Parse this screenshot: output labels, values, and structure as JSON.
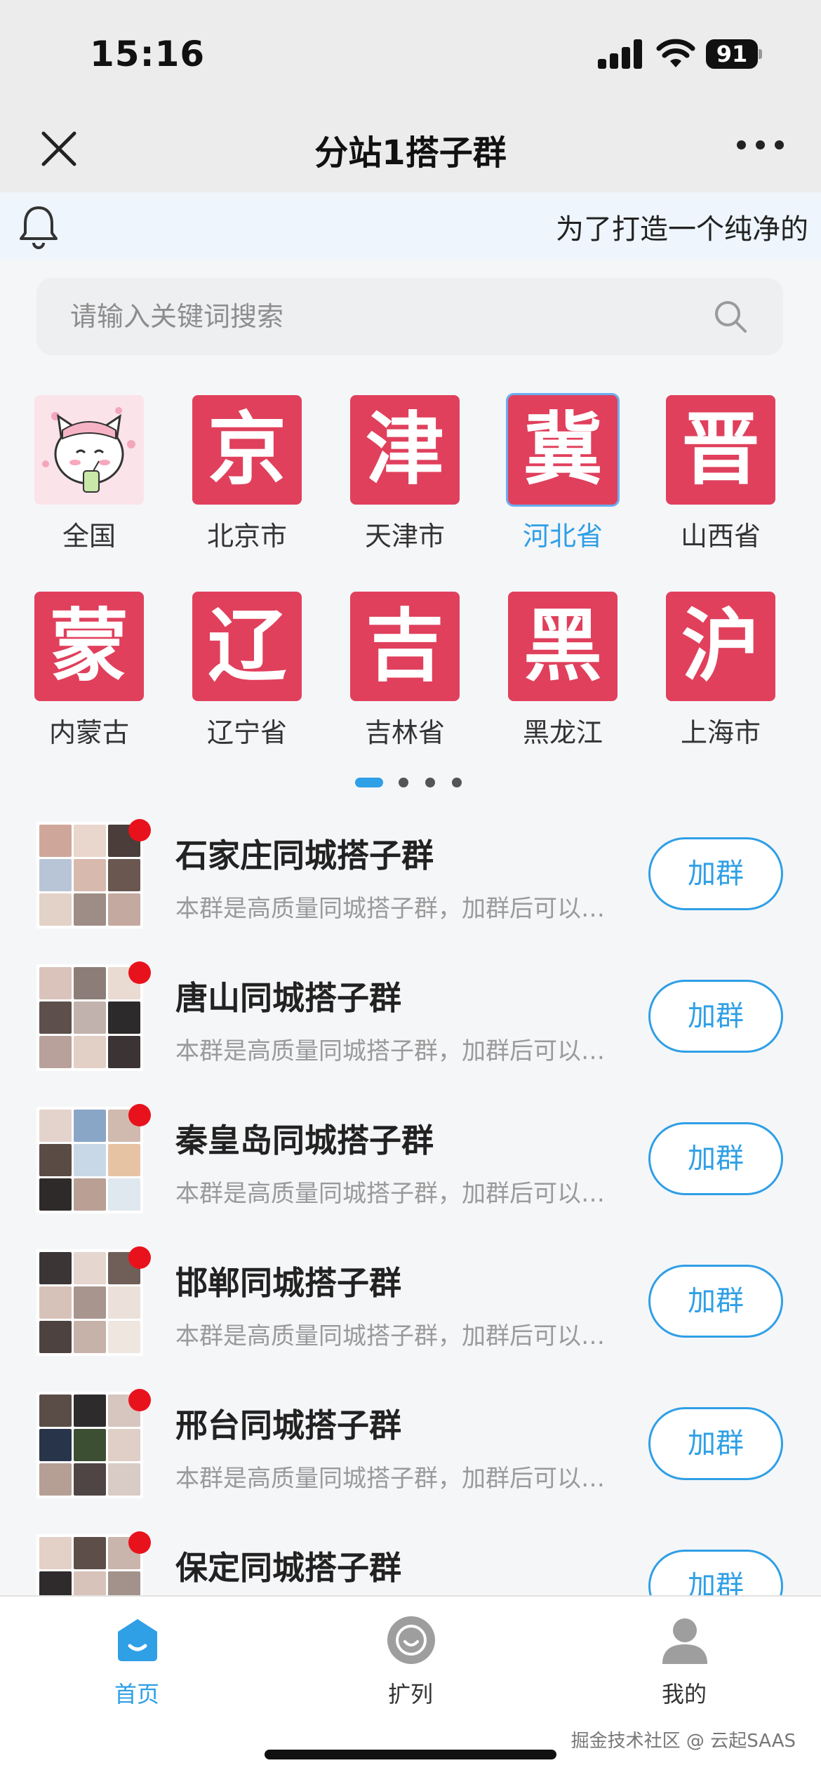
{
  "status_bar": {
    "time": "15:16",
    "battery": "91"
  },
  "nav": {
    "title": "分站1搭子群"
  },
  "notice": {
    "text": "为了打造一个纯净的"
  },
  "search": {
    "placeholder": "请输入关键词搜索"
  },
  "regions": [
    {
      "char": "",
      "name": "全国",
      "selected": false,
      "avatar": true
    },
    {
      "char": "京",
      "name": "北京市",
      "selected": false
    },
    {
      "char": "津",
      "name": "天津市",
      "selected": false
    },
    {
      "char": "冀",
      "name": "河北省",
      "selected": true
    },
    {
      "char": "晋",
      "name": "山西省",
      "selected": false
    },
    {
      "char": "蒙",
      "name": "内蒙古",
      "selected": false
    },
    {
      "char": "辽",
      "name": "辽宁省",
      "selected": false
    },
    {
      "char": "吉",
      "name": "吉林省",
      "selected": false
    },
    {
      "char": "黑",
      "name": "黑龙江",
      "selected": false
    },
    {
      "char": "沪",
      "name": "上海市",
      "selected": false
    }
  ],
  "pager": {
    "page_count": 4,
    "active_page": 1
  },
  "groups": [
    {
      "title": "石家庄同城搭子群",
      "desc": "本群是高质量同城搭子群，加群后可以…",
      "button": "加群"
    },
    {
      "title": "唐山同城搭子群",
      "desc": "本群是高质量同城搭子群，加群后可以…",
      "button": "加群"
    },
    {
      "title": "秦皇岛同城搭子群",
      "desc": "本群是高质量同城搭子群，加群后可以…",
      "button": "加群"
    },
    {
      "title": "邯郸同城搭子群",
      "desc": "本群是高质量同城搭子群，加群后可以…",
      "button": "加群"
    },
    {
      "title": "邢台同城搭子群",
      "desc": "本群是高质量同城搭子群，加群后可以…",
      "button": "加群"
    },
    {
      "title": "保定同城搭子群",
      "desc": "",
      "button": "加群"
    }
  ],
  "tabs": [
    {
      "label": "首页",
      "icon": "home-icon",
      "active": true
    },
    {
      "label": "扩列",
      "icon": "smile-icon",
      "active": false
    },
    {
      "label": "我的",
      "icon": "profile-icon",
      "active": false
    }
  ],
  "watermark": "掘金技术社区 @ 云起SAAS",
  "colors": {
    "accent": "#2f9fe6",
    "tile_red": "#e0405c",
    "badge_red": "#e8121d"
  }
}
